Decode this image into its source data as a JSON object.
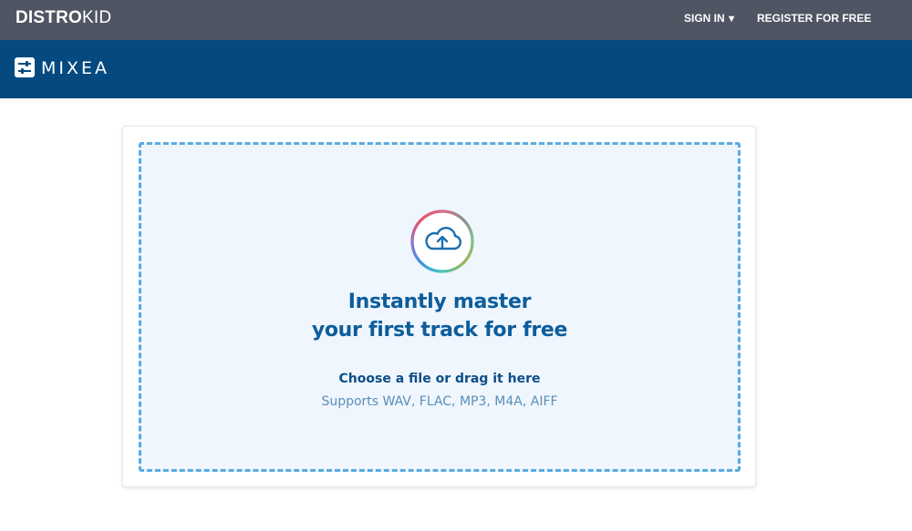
{
  "topbar": {
    "brand_bold": "DISTRO",
    "brand_light": "KID",
    "sign_in_label": "SIGN IN",
    "sign_in_caret": "▼",
    "register_label": "REGISTER FOR FREE",
    "background": "#4f5563"
  },
  "subbar": {
    "product_name": "MIXEA",
    "logo_icon": "sliders-icon",
    "background": "#044a80"
  },
  "upload": {
    "icon": "cloud-upload-icon",
    "headline_line1": "Instantly master",
    "headline_line2": "your first track for free",
    "choose_text": "Choose a file or drag it here",
    "supports_text": "Supports WAV, FLAC, MP3, M4A, AIFF",
    "accent_color": "#0d5d9b",
    "dash_color": "#5aaae0"
  }
}
